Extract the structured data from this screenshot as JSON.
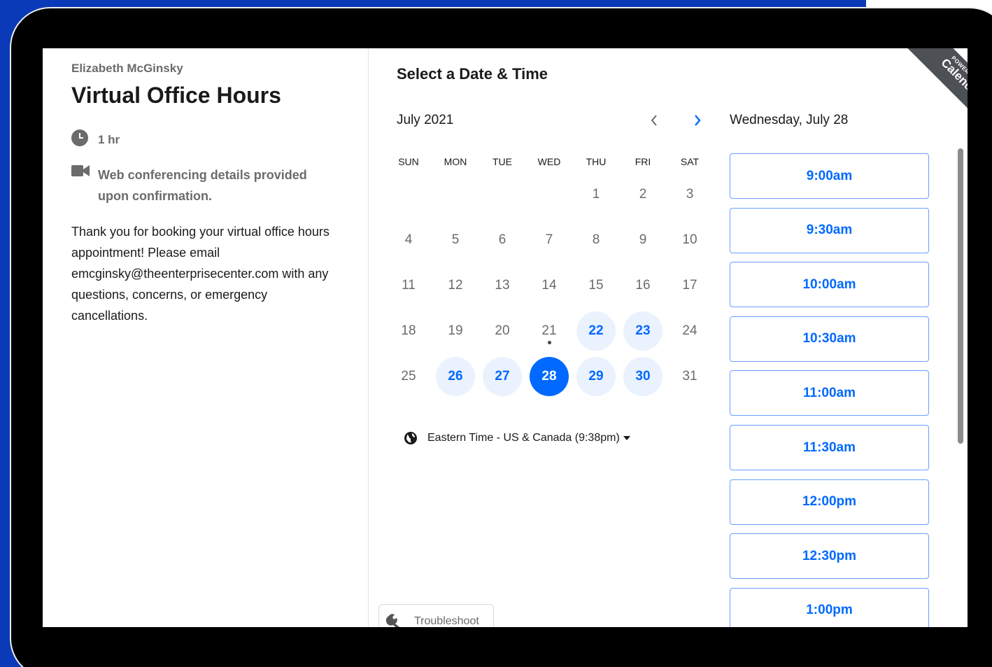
{
  "event": {
    "host": "Elizabeth McGinsky",
    "title": "Virtual Office Hours",
    "duration": "1 hr",
    "conferencing": "Web conferencing details provided upon confirmation.",
    "description": "Thank you for booking your virtual office hours appointment! Please email emcginsky@theenterprisecenter.com with any questions, concerns, or emergency cancellations."
  },
  "scheduler": {
    "heading": "Select a Date & Time",
    "month": "July 2021",
    "weekdays": [
      "SUN",
      "MON",
      "TUE",
      "WED",
      "THU",
      "FRI",
      "SAT"
    ],
    "days": [
      {
        "d": "1",
        "s": "n"
      },
      {
        "d": "2",
        "s": "n"
      },
      {
        "d": "3",
        "s": "n"
      },
      {
        "d": "4",
        "s": "n"
      },
      {
        "d": "5",
        "s": "n"
      },
      {
        "d": "6",
        "s": "n"
      },
      {
        "d": "7",
        "s": "n"
      },
      {
        "d": "8",
        "s": "n"
      },
      {
        "d": "9",
        "s": "n"
      },
      {
        "d": "10",
        "s": "n"
      },
      {
        "d": "11",
        "s": "n"
      },
      {
        "d": "12",
        "s": "n"
      },
      {
        "d": "13",
        "s": "n"
      },
      {
        "d": "14",
        "s": "n"
      },
      {
        "d": "15",
        "s": "n"
      },
      {
        "d": "16",
        "s": "n"
      },
      {
        "d": "17",
        "s": "n"
      },
      {
        "d": "18",
        "s": "n"
      },
      {
        "d": "19",
        "s": "n"
      },
      {
        "d": "20",
        "s": "n"
      },
      {
        "d": "21",
        "s": "n"
      },
      {
        "d": "22",
        "s": "a"
      },
      {
        "d": "23",
        "s": "a"
      },
      {
        "d": "24",
        "s": "n"
      },
      {
        "d": "25",
        "s": "n"
      },
      {
        "d": "26",
        "s": "a"
      },
      {
        "d": "27",
        "s": "a"
      },
      {
        "d": "28",
        "s": "s"
      },
      {
        "d": "29",
        "s": "a"
      },
      {
        "d": "30",
        "s": "a"
      },
      {
        "d": "31",
        "s": "n"
      }
    ],
    "timezone": "Eastern Time - US & Canada (9:38pm)",
    "selected_date": "Wednesday, July 28",
    "slots": [
      "9:00am",
      "9:30am",
      "10:00am",
      "10:30am",
      "11:00am",
      "11:30am",
      "12:00pm",
      "12:30pm",
      "1:00pm"
    ]
  },
  "troubleshoot_label": "Troubleshoot",
  "badge": {
    "line1": "POWERED BY",
    "line2": "Calendly"
  },
  "colors": {
    "accent": "#0069ff",
    "available_bg": "#eaf2fe",
    "backdrop": "#0a3ab8"
  },
  "icons": [
    "clock-icon",
    "video-camera-icon",
    "chevron-left-icon",
    "chevron-right-icon",
    "globe-icon",
    "caret-down-icon",
    "wrench-icon"
  ]
}
